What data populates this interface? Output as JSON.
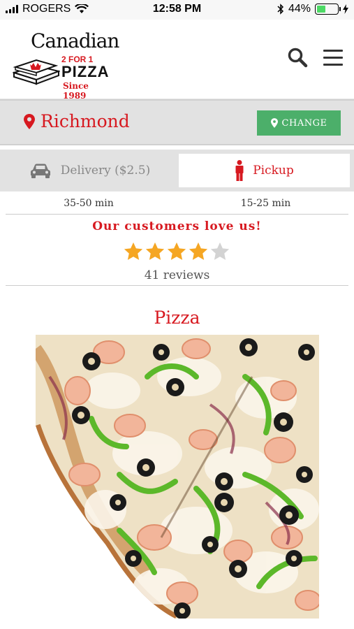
{
  "status_bar": {
    "carrier": "ROGERS",
    "time": "12:58 PM",
    "battery_percent": "44%",
    "battery_level": 0.44,
    "icons": [
      "signal-icon",
      "wifi-icon",
      "bluetooth-icon",
      "battery-icon",
      "charging-icon"
    ]
  },
  "header": {
    "logo": {
      "line1": "Canadian",
      "line2": "2 FOR 1",
      "line3": "PIZZA",
      "line4": "Since 1989"
    },
    "icons": [
      "search-icon",
      "hamburger-menu-icon"
    ]
  },
  "location": {
    "city": "Richmond",
    "change_label": "CHANGE",
    "icon": "map-pin-icon"
  },
  "tabs": {
    "delivery_label": "Delivery ($2.5)",
    "pickup_label": "Pickup",
    "selected": "Pickup",
    "delivery_time": "35-50 min",
    "pickup_time": "15-25 min"
  },
  "reviews": {
    "heading": "Our customers love us!",
    "rating": 4,
    "max_rating": 5,
    "count_label": "41 reviews"
  },
  "menu": {
    "section_title": "Pizza"
  },
  "colors": {
    "brand_red": "#d71920",
    "change_green": "#4caf6a",
    "star_gold": "#f5a623",
    "star_empty": "#d3d3d3"
  }
}
